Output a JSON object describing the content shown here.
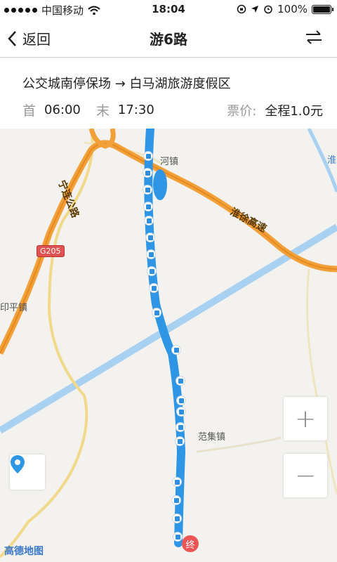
{
  "status": {
    "carrier": "中国移动",
    "time": "18:04",
    "battery": "100%"
  },
  "nav": {
    "back_label": "返回",
    "title": "游6路"
  },
  "route": {
    "name": "公交城南停保场 → 白马湖旅游度假区",
    "first_label": "首",
    "first_time": "06:00",
    "last_label": "末",
    "last_time": "17:30",
    "fare_label": "票价:",
    "fare_value": "全程1.0元"
  },
  "map": {
    "places": [
      "河镇",
      "印平镇",
      "范集镇",
      "淮"
    ],
    "roads": [
      "宁连公路",
      "淮徐高速"
    ],
    "highway_shield": "G205",
    "end_marker": "终",
    "logo": "高德地图",
    "zoom_in": "+",
    "zoom_out": "−"
  }
}
